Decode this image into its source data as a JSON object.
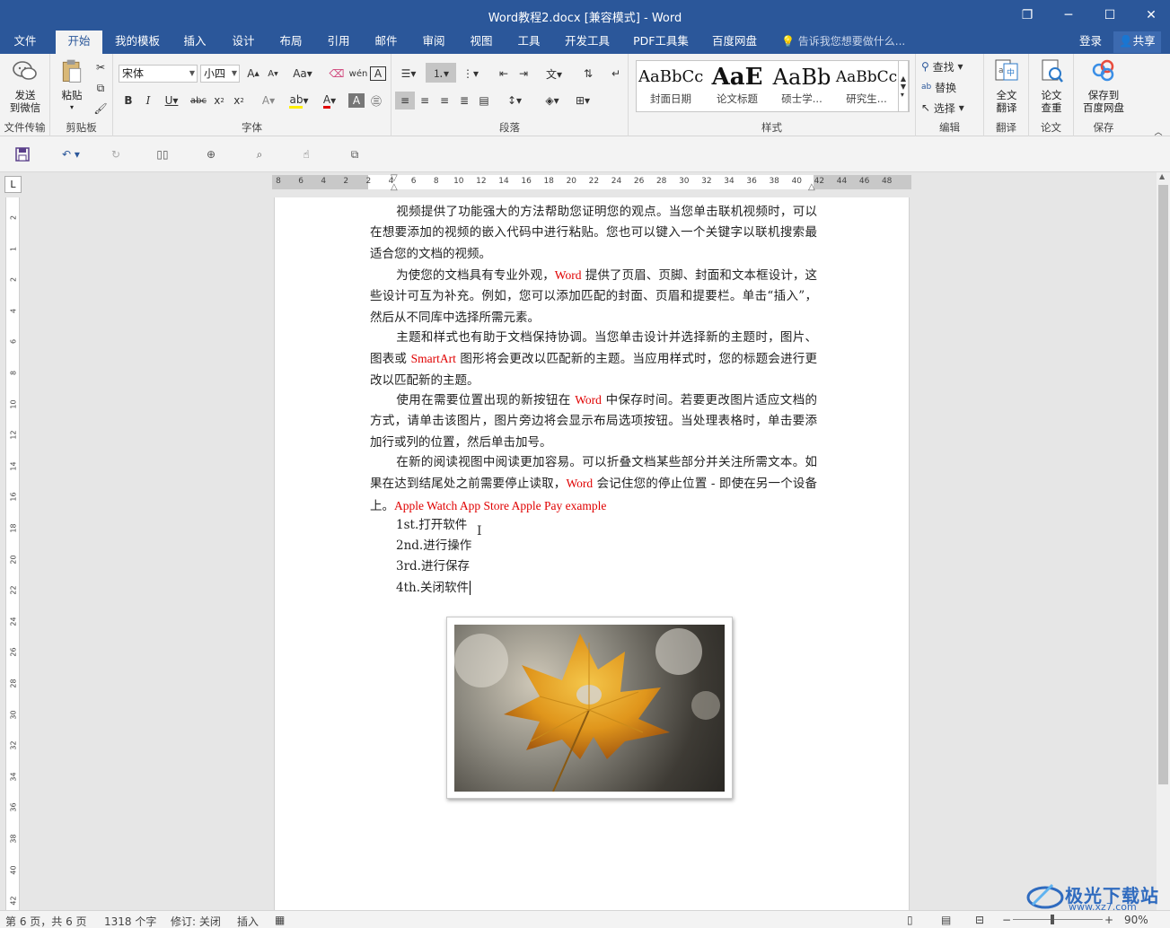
{
  "window": {
    "title": "Word教程2.docx [兼容模式] - Word",
    "buttons": {
      "restore": "❐",
      "minimize": "─",
      "maximize": "☐",
      "close": "✕"
    }
  },
  "tabs": [
    {
      "label": "文件"
    },
    {
      "label": "开始"
    },
    {
      "label": "我的模板"
    },
    {
      "label": "插入"
    },
    {
      "label": "设计"
    },
    {
      "label": "布局"
    },
    {
      "label": "引用"
    },
    {
      "label": "邮件"
    },
    {
      "label": "审阅"
    },
    {
      "label": "视图"
    },
    {
      "label": "工具"
    },
    {
      "label": "开发工具"
    },
    {
      "label": "PDF工具集"
    },
    {
      "label": "百度网盘"
    }
  ],
  "active_tab": "开始",
  "tell_me": "告诉我您想要做什么...",
  "login": "登录",
  "share": "共享",
  "ribbon": {
    "wechat": {
      "label1": "发送",
      "label2": "到微信",
      "group": "文件传输"
    },
    "clipboard": {
      "paste": "粘贴",
      "group": "剪贴板"
    },
    "font": {
      "name": "宋体",
      "size": "小四",
      "group": "字体"
    },
    "paragraph": {
      "group": "段落"
    },
    "styles": {
      "items": [
        {
          "preview": "AaBbCc",
          "name": "封面日期"
        },
        {
          "preview": "AaE",
          "name": "论文标题"
        },
        {
          "preview": "AaBb",
          "name": "硕士学..."
        },
        {
          "preview": "AaBbCc",
          "name": "研究生..."
        }
      ],
      "group": "样式"
    },
    "editing": {
      "find": "查找",
      "replace": "替换",
      "select": "选择",
      "group": "编辑"
    },
    "translate": {
      "label1": "全文",
      "label2": "翻译",
      "group": "翻译"
    },
    "paper": {
      "label1": "论文",
      "label2": "查重",
      "group": "论文"
    },
    "save": {
      "label1": "保存到",
      "label2": "百度网盘",
      "group": "保存"
    }
  },
  "ruler": {
    "h_numbers": [
      "8",
      "6",
      "4",
      "2",
      "2",
      "4",
      "6",
      "8",
      "10",
      "12",
      "14",
      "16",
      "18",
      "20",
      "22",
      "24",
      "26",
      "28",
      "30",
      "32",
      "34",
      "36",
      "38",
      "40",
      "42",
      "44",
      "46",
      "48"
    ],
    "v_numbers": [
      "2",
      "1",
      "2",
      "4",
      "6",
      "8",
      "10",
      "12",
      "14",
      "16",
      "18",
      "20",
      "22",
      "24",
      "26",
      "28",
      "30",
      "32",
      "34",
      "36",
      "38",
      "40",
      "42"
    ]
  },
  "document": {
    "paragraphs": [
      {
        "parts": [
          {
            "t": "视频提供了功能强大的方法帮助您证明您的观点。当您单击联机视频时，可以在想要添加的视频的嵌入代码中进行粘贴。您也可以键入一个关键字以联机搜索最适合您的文档的视频。"
          }
        ]
      },
      {
        "parts": [
          {
            "t": "为使您的文档具有专业外观，"
          },
          {
            "t": "Word",
            "red": true
          },
          {
            "t": " 提供了页眉、页脚、封面和文本框设计，这些设计可互为补充。例如，您可以添加匹配的封面、页眉和提要栏。单击“插入”，然后从不同库中选择所需元素。"
          }
        ]
      },
      {
        "parts": [
          {
            "t": "主题和样式也有助于文档保持协调。当您单击设计并选择新的主题时，图片、图表或 "
          },
          {
            "t": "SmartArt",
            "red": true
          },
          {
            "t": " 图形将会更改以匹配新的主题。当应用样式时，您的标题会进行更改以匹配新的主题。"
          }
        ]
      },
      {
        "parts": [
          {
            "t": "使用在需要位置出现的新按钮在 "
          },
          {
            "t": "Word",
            "red": true
          },
          {
            "t": " 中保存时间。若要更改图片适应文档的方式，请单击该图片，图片旁边将会显示布局选项按钮。当处理表格时，单击要添加行或列的位置，然后单击加号。"
          }
        ]
      },
      {
        "parts": [
          {
            "t": "在新的阅读视图中阅读更加容易。可以折叠文档某些部分并关注所需文本。如果在达到结尾处之前需要停止读取，"
          },
          {
            "t": "Word",
            "red": true
          },
          {
            "t": " 会记住您的停止位置 - 即使在另一个设备上。"
          },
          {
            "t": "Apple Watch   App Store   Apple Pay   example",
            "red": true
          }
        ]
      }
    ],
    "list": [
      "1st.打开软件",
      "2nd.进行操作",
      "3rd.进行保存",
      "4th.关闭软件"
    ]
  },
  "status": {
    "page": "第 6 页，共 6 页",
    "words": "1318 个字",
    "revision": "修订: 关闭",
    "mode": "插入",
    "zoom": "90%"
  },
  "watermark": {
    "title": "极光下载站",
    "url": "www.xz7.com"
  },
  "colors": {
    "accent": "#2b579a",
    "red_text": "#e00000"
  }
}
